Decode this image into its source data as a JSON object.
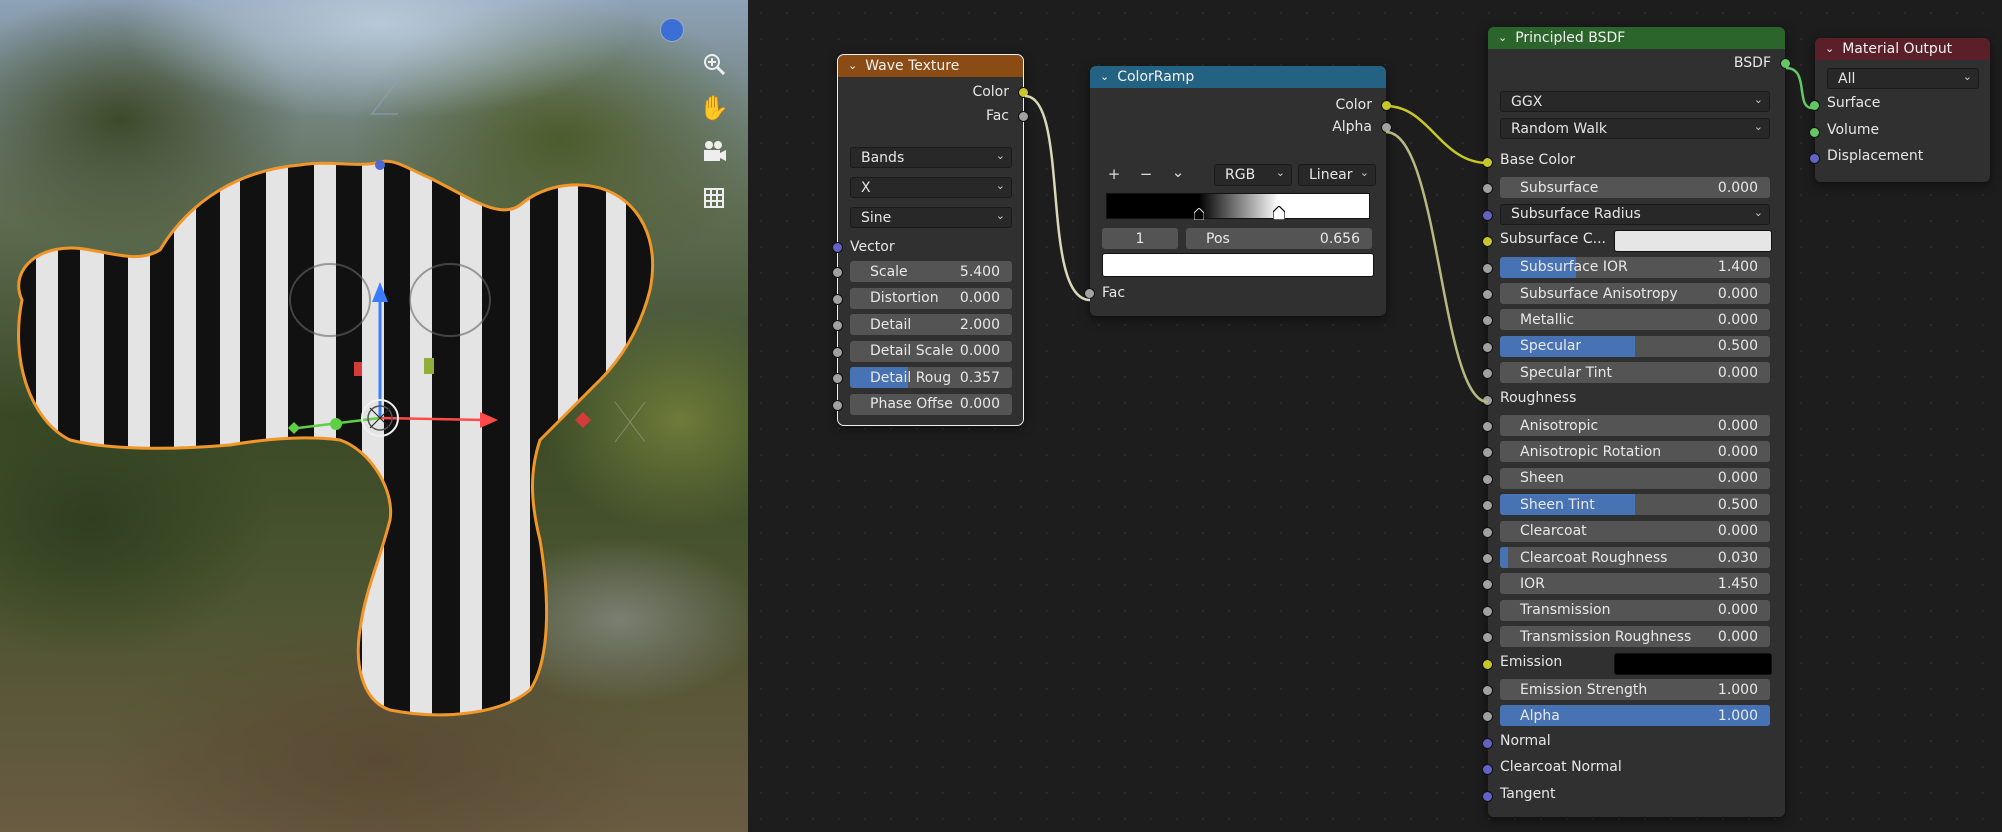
{
  "viewport": {
    "tools": [
      "zoom-icon",
      "hand-pan-icon",
      "camera-icon",
      "grid-icon"
    ]
  },
  "wave_texture": {
    "title": "Wave Texture",
    "header_color": "#8a4b15",
    "outputs": [
      "Color",
      "Fac"
    ],
    "dropdowns": [
      "Bands",
      "X",
      "Sine"
    ],
    "vector_label": "Vector",
    "fields": [
      {
        "label": "Scale",
        "value": "5.400",
        "fill": 0
      },
      {
        "label": "Distortion",
        "value": "0.000",
        "fill": 0
      },
      {
        "label": "Detail",
        "value": "2.000",
        "fill": 0
      },
      {
        "label": "Detail Scale",
        "value": "0.000",
        "fill": 0
      },
      {
        "label": "Detail Roug",
        "value": "0.357",
        "fill": 0.357
      },
      {
        "label": "Phase Offse",
        "value": "0.000",
        "fill": 0
      }
    ]
  },
  "color_ramp": {
    "title": "ColorRamp",
    "header_color": "#246283",
    "outputs": [
      "Color",
      "Alpha"
    ],
    "add_symbol": "+",
    "remove_symbol": "−",
    "menu_symbol": "⌄",
    "mode": "RGB",
    "interpolation": "Linear",
    "index": "1",
    "pos_label": "Pos",
    "pos_value": "0.656",
    "stops": [
      0.35,
      0.656
    ],
    "input_label": "Fac"
  },
  "principled": {
    "title": "Principled BSDF",
    "header_color": "#2b652b",
    "output": "BSDF",
    "distribution": "GGX",
    "subsurface_method": "Random Walk",
    "rows": [
      {
        "type": "socket",
        "label": "Base Color",
        "sock": "yellow"
      },
      {
        "type": "field",
        "label": "Subsurface",
        "value": "0.000",
        "fill": 0,
        "sock": "gray"
      },
      {
        "type": "dropdown",
        "label": "Subsurface Radius",
        "sock": "blue"
      },
      {
        "type": "color",
        "label": "Subsurface C...",
        "swatch": "#e6e6e6",
        "sock": "yellow"
      },
      {
        "type": "field",
        "label": "Subsurface IOR",
        "value": "1.400",
        "fill": 0.28,
        "sock": "gray"
      },
      {
        "type": "field",
        "label": "Subsurface Anisotropy",
        "value": "0.000",
        "fill": 0,
        "sock": "gray"
      },
      {
        "type": "field",
        "label": "Metallic",
        "value": "0.000",
        "fill": 0,
        "sock": "gray"
      },
      {
        "type": "field",
        "label": "Specular",
        "value": "0.500",
        "fill": 0.5,
        "sock": "gray"
      },
      {
        "type": "field",
        "label": "Specular Tint",
        "value": "0.000",
        "fill": 0,
        "sock": "gray"
      },
      {
        "type": "socket",
        "label": "Roughness",
        "sock": "gray"
      },
      {
        "type": "field",
        "label": "Anisotropic",
        "value": "0.000",
        "fill": 0,
        "sock": "gray"
      },
      {
        "type": "field",
        "label": "Anisotropic Rotation",
        "value": "0.000",
        "fill": 0,
        "sock": "gray"
      },
      {
        "type": "field",
        "label": "Sheen",
        "value": "0.000",
        "fill": 0,
        "sock": "gray"
      },
      {
        "type": "field",
        "label": "Sheen Tint",
        "value": "0.500",
        "fill": 0.5,
        "sock": "gray"
      },
      {
        "type": "field",
        "label": "Clearcoat",
        "value": "0.000",
        "fill": 0,
        "sock": "gray"
      },
      {
        "type": "field",
        "label": "Clearcoat Roughness",
        "value": "0.030",
        "fill": 0.03,
        "sock": "gray"
      },
      {
        "type": "field",
        "label": "IOR",
        "value": "1.450",
        "fill": 0,
        "sock": "gray"
      },
      {
        "type": "field",
        "label": "Transmission",
        "value": "0.000",
        "fill": 0,
        "sock": "gray"
      },
      {
        "type": "field",
        "label": "Transmission Roughness",
        "value": "0.000",
        "fill": 0,
        "sock": "gray"
      },
      {
        "type": "color",
        "label": "Emission",
        "swatch": "#000000",
        "sock": "yellow"
      },
      {
        "type": "field",
        "label": "Emission Strength",
        "value": "1.000",
        "fill": 0,
        "sock": "gray"
      },
      {
        "type": "field",
        "label": "Alpha",
        "value": "1.000",
        "fill": 1,
        "sock": "gray"
      },
      {
        "type": "socket",
        "label": "Normal",
        "sock": "blue"
      },
      {
        "type": "socket",
        "label": "Clearcoat Normal",
        "sock": "blue"
      },
      {
        "type": "socket",
        "label": "Tangent",
        "sock": "blue"
      }
    ]
  },
  "material_output": {
    "title": "Material Output",
    "header_color": "#5a1f28",
    "target": "All",
    "inputs": [
      "Surface",
      "Volume",
      "Displacement"
    ]
  }
}
